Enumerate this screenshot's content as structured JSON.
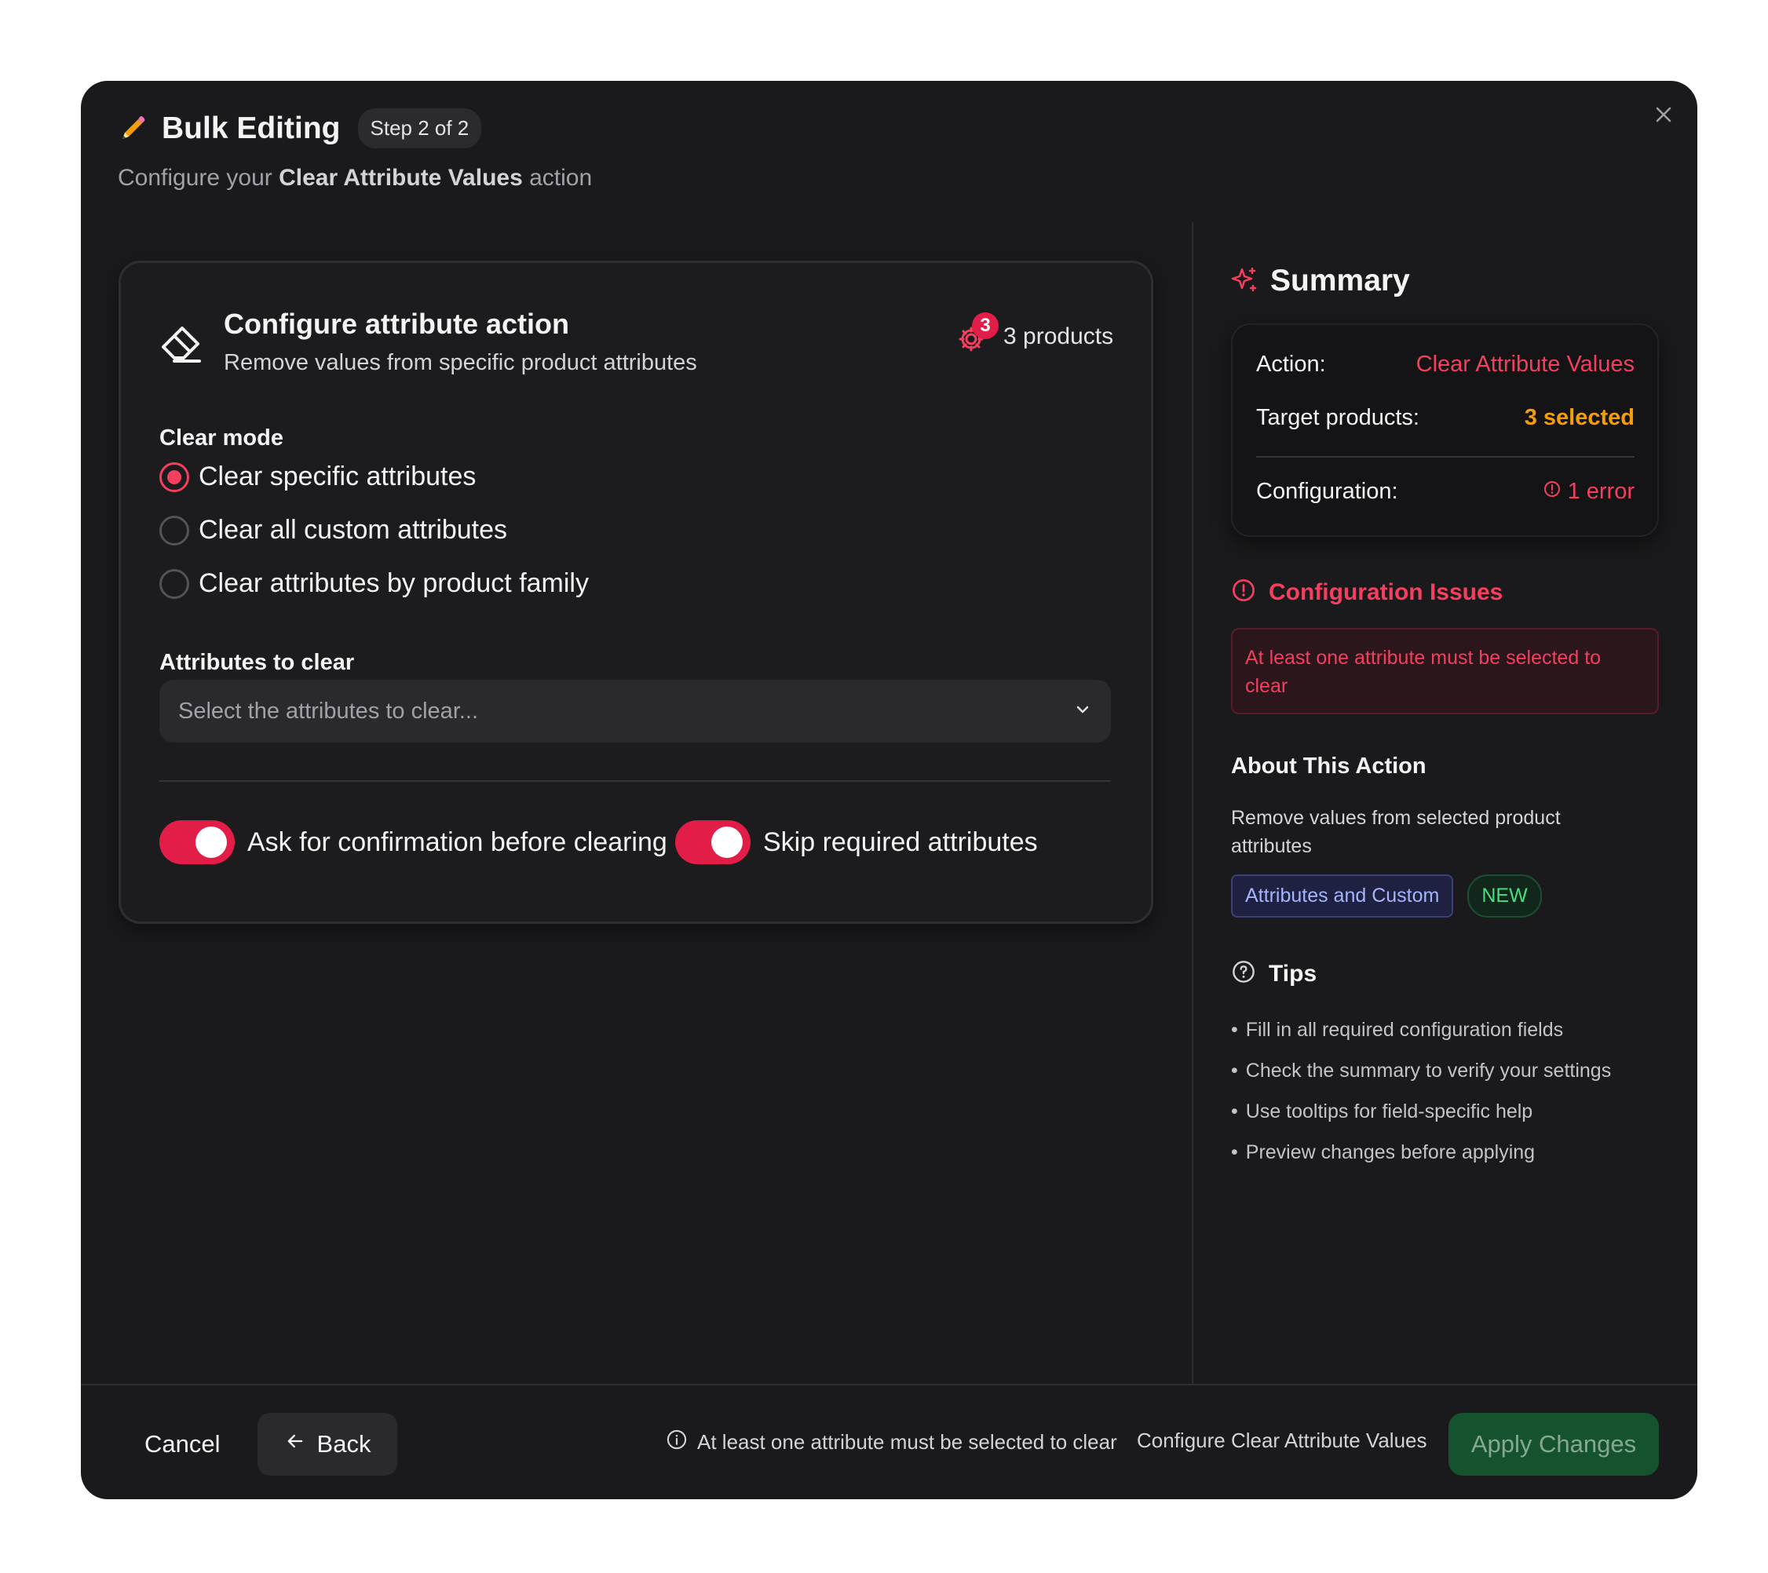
{
  "header": {
    "title": "Bulk Editing",
    "step": "Step 2 of 2",
    "subtitle_prefix": "Configure your",
    "subtitle_action": "Clear Attribute Values",
    "subtitle_suffix": "action"
  },
  "card": {
    "title": "Configure attribute action",
    "description": "Remove values from specific product attributes",
    "products_count": "3",
    "products_label": "3 products",
    "clear_mode_label": "Clear mode",
    "radio_options": [
      {
        "label": "Clear specific attributes",
        "checked": true
      },
      {
        "label": "Clear all custom attributes",
        "checked": false
      },
      {
        "label": "Clear attributes by product family",
        "checked": false
      }
    ],
    "attributes_label": "Attributes to clear",
    "select_placeholder": "Select the attributes to clear...",
    "toggles": [
      {
        "label": "Ask for confirmation before clearing",
        "on": true
      },
      {
        "label": "Skip required attributes",
        "on": true
      }
    ]
  },
  "summary": {
    "title": "Summary",
    "action_key": "Action:",
    "action_value": "Clear Attribute Values",
    "target_key": "Target products:",
    "target_value": "3 selected",
    "config_key": "Configuration:",
    "config_value": "1 error"
  },
  "issues": {
    "title": "Configuration Issues",
    "message": "At least one attribute must be selected to clear"
  },
  "about": {
    "title": "About This Action",
    "description": "Remove values from selected product attributes",
    "tag": "Attributes and Custom",
    "badge": "NEW"
  },
  "tips": {
    "title": "Tips",
    "items": [
      "Fill in all required configuration fields",
      "Check the summary to verify your settings",
      "Use tooltips for field-specific help",
      "Preview changes before applying"
    ]
  },
  "footer": {
    "cancel": "Cancel",
    "back": "Back",
    "warning": "At least one attribute must be selected to clear",
    "config_label": "Configure Clear Attribute Values",
    "apply": "Apply Changes"
  },
  "colors": {
    "accent_red": "#f43f5e",
    "amber": "#f59e0b",
    "apply_green": "#14532d",
    "background": "#1a1a1c"
  },
  "icons": [
    "pencil-icon",
    "close-icon",
    "eraser-icon",
    "gear-icon",
    "chevron-down-icon",
    "sparkle-icon",
    "alert-circle-icon",
    "help-circle-icon",
    "arrow-left-icon",
    "info-icon"
  ]
}
